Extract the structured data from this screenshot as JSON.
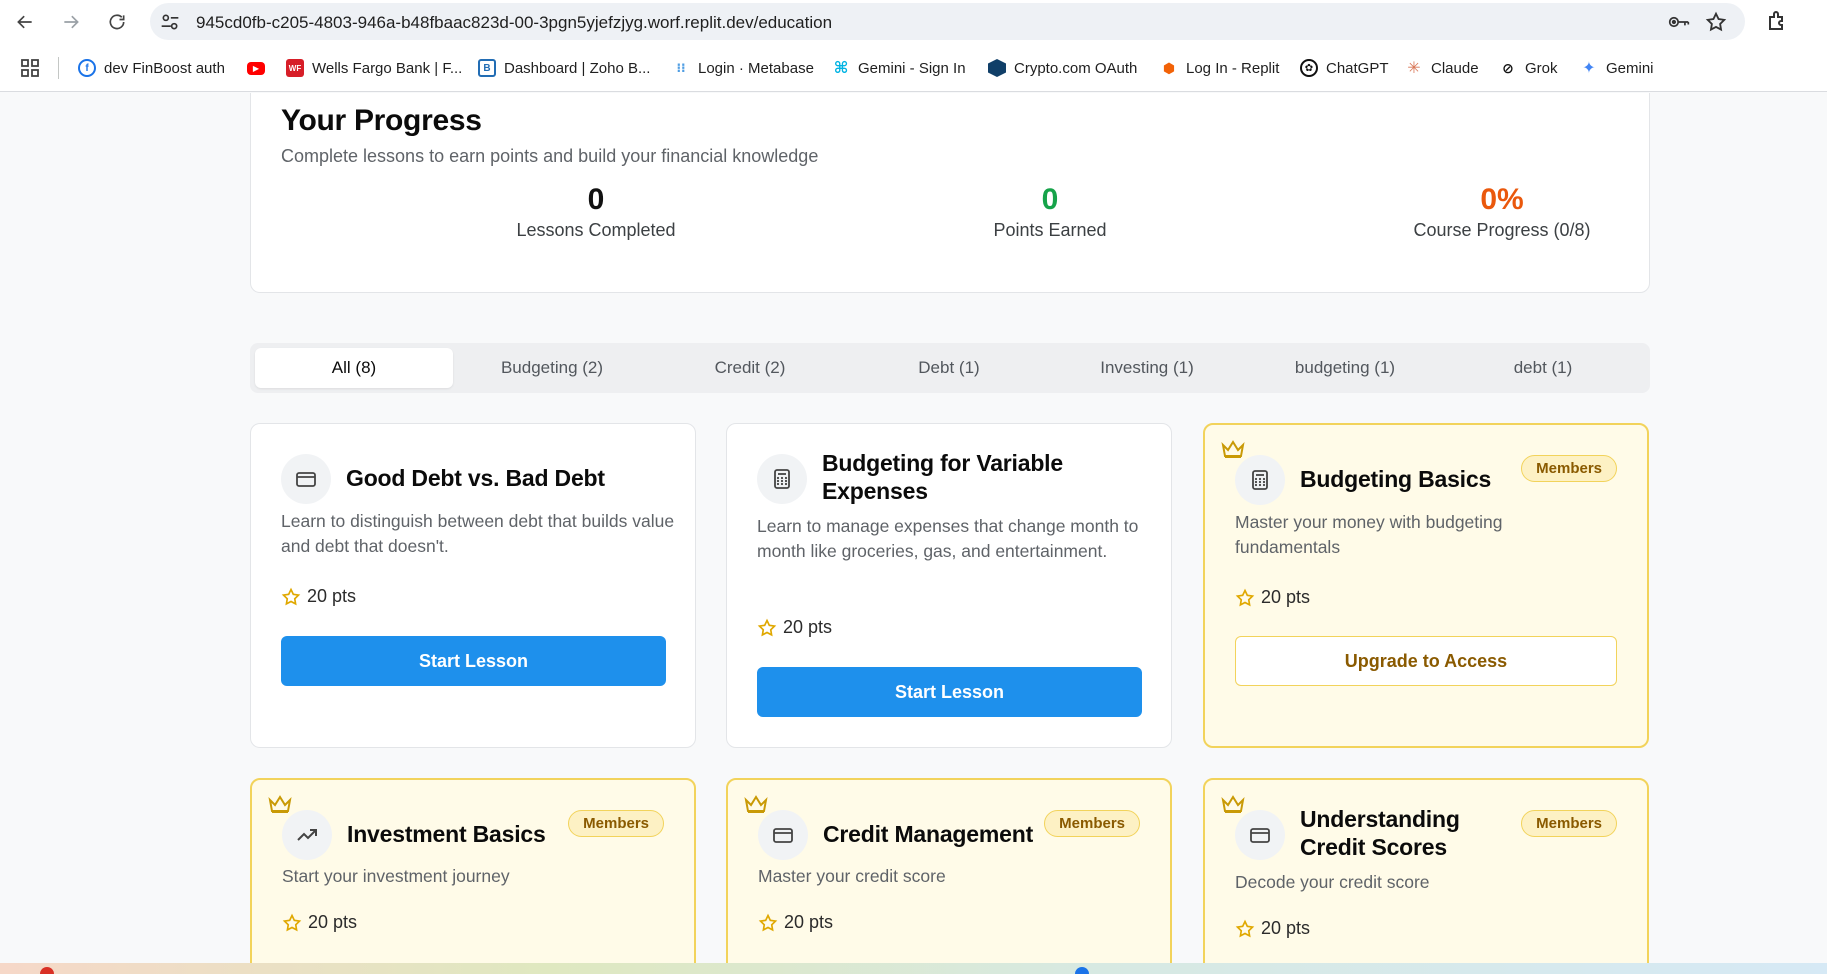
{
  "browser": {
    "url": "945cd0fb-c205-4803-946a-b48fbaac823d-00-3pgn5yjefzjyg.worf.replit.dev/education"
  },
  "bookmarks": [
    {
      "label": "dev FinBoost auth",
      "icon": "finboost-icon",
      "color": "#1a73e8"
    },
    {
      "label": "",
      "icon": "youtube-icon",
      "color": "#ff0000"
    },
    {
      "label": "Wells Fargo Bank | F...",
      "icon": "wells-fargo-icon",
      "color": "#d71e28"
    },
    {
      "label": "Dashboard | Zoho B...",
      "icon": "zoho-icon",
      "color": "#226db4"
    },
    {
      "label": "Login · Metabase",
      "icon": "metabase-icon",
      "color": "#509ee3"
    },
    {
      "label": "Gemini - Sign In",
      "icon": "gemini-signin-icon",
      "color": "#00b3e3"
    },
    {
      "label": "Crypto.com OAuth",
      "icon": "crypto-icon",
      "color": "#103f68"
    },
    {
      "label": "Log In - Replit",
      "icon": "replit-icon",
      "color": "#f26207"
    },
    {
      "label": "ChatGPT",
      "icon": "chatgpt-icon",
      "color": "#111111"
    },
    {
      "label": "Claude",
      "icon": "claude-icon",
      "color": "#d97757"
    },
    {
      "label": "Grok",
      "icon": "grok-icon",
      "color": "#111111"
    },
    {
      "label": "Gemini",
      "icon": "gemini-icon",
      "color": "#4285f4"
    }
  ],
  "progress": {
    "title": "Your Progress",
    "subtitle": "Complete lessons to earn points and build your financial knowledge",
    "stats": [
      {
        "value": "0",
        "label": "Lessons Completed",
        "color": "#111111"
      },
      {
        "value": "0",
        "label": "Points Earned",
        "color": "#16a34a"
      },
      {
        "value": "0%",
        "label": "Course Progress (0/8)",
        "color": "#ea580c"
      }
    ]
  },
  "tabs": [
    "All (8)",
    "Budgeting (2)",
    "Credit (2)",
    "Debt (1)",
    "Investing (1)",
    "budgeting (1)",
    "debt (1)"
  ],
  "lessons": [
    {
      "title": "Good Debt vs. Bad Debt",
      "description": "Learn to distinguish between debt that builds value and debt that doesn't.",
      "points": "20 pts",
      "action": "Start Lesson",
      "icon": "credit-card-icon",
      "premium": false
    },
    {
      "title": "Budgeting for Variable Expenses",
      "description": "Learn to manage expenses that change month to month like groceries, gas, and entertainment.",
      "points": "20 pts",
      "action": "Start Lesson",
      "icon": "calculator-icon",
      "premium": false
    },
    {
      "title": "Budgeting Basics",
      "description": "Master your money with budgeting fundamentals",
      "points": "20 pts",
      "action": "Upgrade to Access",
      "badge": "Members",
      "icon": "calculator-icon",
      "premium": true
    },
    {
      "title": "Investment Basics",
      "description": "Start your investment journey",
      "points": "20 pts",
      "badge": "Members",
      "icon": "trending-up-icon",
      "premium": true
    },
    {
      "title": "Credit Management",
      "description": "Master your credit score",
      "points": "20 pts",
      "badge": "Members",
      "icon": "credit-card-icon",
      "premium": true
    },
    {
      "title": "Understanding Credit Scores",
      "description": "Decode your credit score",
      "points": "20 pts",
      "badge": "Members",
      "icon": "credit-card-icon",
      "premium": true
    }
  ],
  "colors": {
    "primary_button": "#1e90ec",
    "premium_bg": "#fffbe8",
    "premium_border": "#f2d35b",
    "badge_text": "#8a5a00",
    "star": "#e0a800"
  }
}
